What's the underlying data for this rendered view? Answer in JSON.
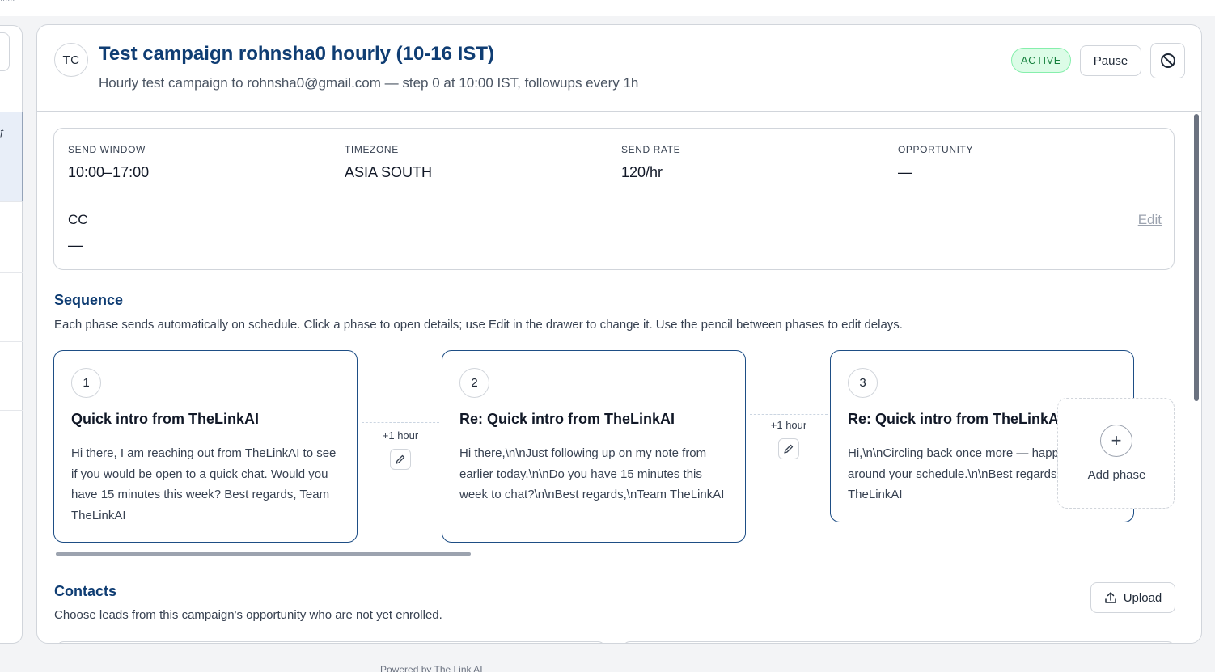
{
  "campaign": {
    "avatar": "TC",
    "title": "Test campaign rohnsha0 hourly (10-16 IST)",
    "subtitle": "Hourly test campaign to rohnsha0@gmail.com — step 0 at 10:00 IST, followups every 1h",
    "status": "ACTIVE",
    "pause_label": "Pause",
    "stop_icon": "block-icon"
  },
  "settings": {
    "send_window": {
      "label": "SEND WINDOW",
      "value": "10:00–17:00"
    },
    "timezone": {
      "label": "TIMEZONE",
      "value": "ASIA SOUTH"
    },
    "send_rate": {
      "label": "SEND RATE",
      "value": "120/hr"
    },
    "opportunity": {
      "label": "OPPORTUNITY",
      "value": "—"
    },
    "cc": {
      "label": "CC",
      "value": "—"
    },
    "edit_label": "Edit"
  },
  "sequence": {
    "title": "Sequence",
    "description": "Each phase sends automatically on schedule. Click a phase to open details; use Edit in the drawer to change it. Use the pencil between phases to edit delays.",
    "phases": [
      {
        "number": "1",
        "title": "Quick intro from TheLinkAI",
        "body": "Hi there, I am reaching out from TheLinkAI to see if you would be open to a quick chat. Would you have 15 minutes this week? Best regards, Team TheLinkAI"
      },
      {
        "number": "2",
        "title": "Re: Quick intro from TheLinkAI",
        "body": "Hi there,\\n\\nJust following up on my note from earlier today.\\n\\nDo you have 15 minutes this week to chat?\\n\\nBest regards,\\nTeam TheLinkAI"
      },
      {
        "number": "3",
        "title": "Re: Quick intro from TheLinkAI",
        "body": "Hi,\\n\\nCircling back once more — happy to work around your schedule.\\n\\nBest regards,\\nTeam TheLinkAI"
      }
    ],
    "delays": [
      "+1 hour",
      "+1 hour"
    ],
    "add_phase_label": "Add phase"
  },
  "contacts": {
    "title": "Contacts",
    "description": "Choose leads from this campaign's opportunity who are not yet enrolled.",
    "upload_label": "Upload"
  },
  "footer": {
    "text": "Powered by The Link AI"
  },
  "colors": {
    "accent": "#0f3d73",
    "active_bg": "#dcfce7",
    "active_text": "#15803d"
  }
}
